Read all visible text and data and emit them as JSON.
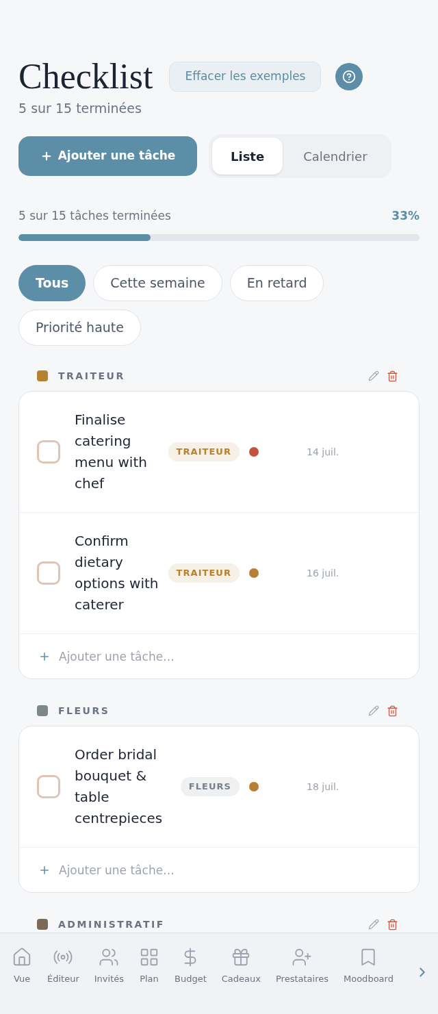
{
  "header": {
    "title": "Checklist",
    "clear_button": "Effacer les exemples",
    "summary": "5 sur 15 terminées"
  },
  "actions": {
    "add_button": "Ajouter une tâche",
    "view_tabs": [
      {
        "label": "Liste",
        "selected": true
      },
      {
        "label": "Calendrier",
        "selected": false
      }
    ]
  },
  "progress": {
    "label": "5 sur 15 tâches terminées",
    "percent": "33%",
    "level": 0.33
  },
  "filters": [
    {
      "label": "Tous",
      "selected": true
    },
    {
      "label": "Cette semaine",
      "selected": false
    },
    {
      "label": "En retard",
      "selected": false
    },
    {
      "label": "Priorité haute",
      "selected": false
    }
  ],
  "categories": [
    {
      "name": "TRAITEUR",
      "color": "#b5822f",
      "tasks": [
        {
          "title": "Finalise catering menu with chef",
          "checked": false,
          "tag": {
            "label": "TRAITEUR",
            "color": "#b5822f"
          },
          "priority_dot": {
            "color": "#c4503e"
          },
          "date": "14 juil."
        },
        {
          "title": "Confirm dietary options with caterer",
          "checked": false,
          "tag": {
            "label": "TRAITEUR",
            "color": "#b5822f"
          },
          "priority_dot": {
            "color": "#b87f34"
          },
          "date": "16 juil."
        }
      ],
      "add_placeholder": "Ajouter une tâche…"
    },
    {
      "name": "FLEURS",
      "color": "#7d868b",
      "tasks": [
        {
          "title": "Order bridal bouquet & table centrepieces",
          "checked": false,
          "tag": {
            "label": "FLEURS",
            "color": "#78808a"
          },
          "priority_dot": {
            "color": "#b87f34"
          },
          "date": "18 juil."
        }
      ],
      "add_placeholder": "Ajouter une tâche…"
    },
    {
      "name": "ADMINISTRATIF",
      "color": "#7a6a57"
    }
  ],
  "bottom_nav": {
    "items": [
      {
        "label": "Vue"
      },
      {
        "label": "Éditeur"
      },
      {
        "label": "Invités"
      },
      {
        "label": "Plan"
      },
      {
        "label": "Budget"
      },
      {
        "label": "Cadeaux"
      },
      {
        "label": "Prestataires"
      },
      {
        "label": "Moodboard"
      }
    ]
  }
}
